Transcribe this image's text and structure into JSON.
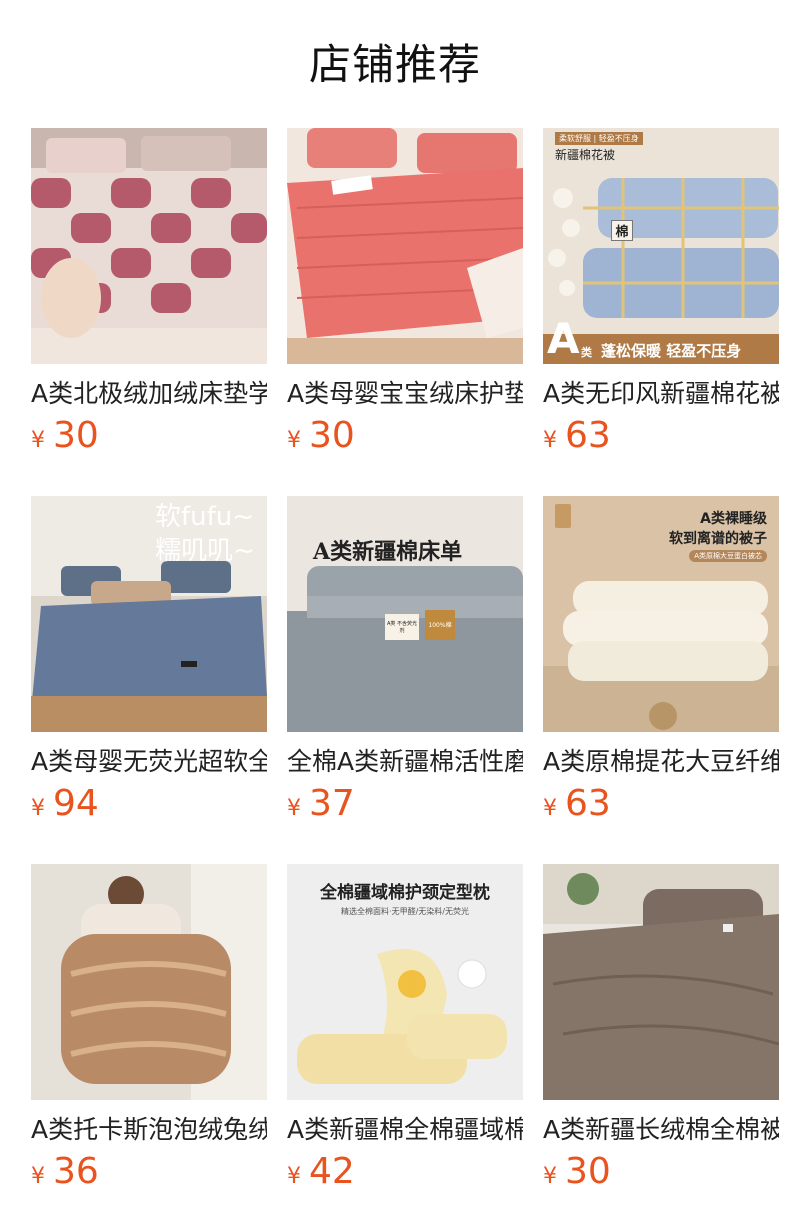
{
  "section_title": "店铺推荐",
  "currency": "¥",
  "products": [
    {
      "name": "A类北极绒加绒床垫学",
      "price": "30",
      "image": "pink-white-plaid-mattress"
    },
    {
      "name": "A类母婴宝宝绒床护垫",
      "price": "30",
      "image": "coral-quilted-mattress"
    },
    {
      "name": "A类无印风新疆棉花被",
      "price": "63",
      "image": "plaid-cotton-quilt",
      "overlay": {
        "tag": "柔软舒服 | 轻盈不压身",
        "title": "新疆棉花被",
        "badge": "棉",
        "big": "A",
        "small": "类",
        "banner": "蓬松保暖 轻盈不压身"
      }
    },
    {
      "name": "A类母婴无荧光超软全",
      "price": "94",
      "image": "blue-bedding-set",
      "overlay": {
        "line1": "软fufu~",
        "line2": "糯叽叽~"
      }
    },
    {
      "name": "全棉A类新疆棉活性磨",
      "price": "37",
      "image": "grey-folded-sheet",
      "overlay": {
        "title": "A类新疆棉床单",
        "label1": "A类 不含荧光剂",
        "label2": "100%棉"
      }
    },
    {
      "name": "A类原棉提花大豆纤维",
      "price": "63",
      "image": "white-soybean-quilt",
      "overlay": {
        "line1": "A类裸睡级",
        "line2": "软到离谱的被子",
        "pill": "A类原棉大豆蛋白被芯"
      }
    },
    {
      "name": "A类托卡斯泡泡绒兔绒",
      "price": "36",
      "image": "fur-blanket-held"
    },
    {
      "name": "A类新疆棉全棉疆域棉",
      "price": "42",
      "image": "yellow-cotton-pillow",
      "overlay": {
        "title": "全棉疆域棉护颈定型枕",
        "sub": "精选全棉面料·无甲醛/无染料/无荧光"
      }
    },
    {
      "name": "A类新疆长绒棉全棉被",
      "price": "30",
      "image": "brown-bedding-set"
    }
  ],
  "colors": {
    "price": "#e8531e",
    "title": "#111111",
    "name": "#222222"
  }
}
